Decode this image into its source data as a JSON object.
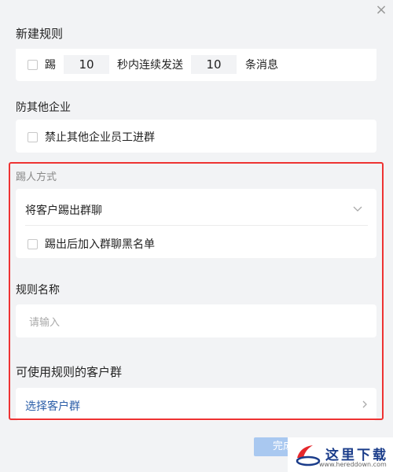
{
  "dialog": {
    "title": "新建规则",
    "close_glyph": "×",
    "complete_label": "完成"
  },
  "spam_rule": {
    "kick_label": "踢",
    "seconds_value": "10",
    "mid_text": "秒内连续发送",
    "count_value": "10",
    "end_text": "条消息"
  },
  "other_company": {
    "section_label": "防其他企业",
    "checkbox_label": "禁止其他企业员工进群"
  },
  "kick_method": {
    "section_label": "踢人方式",
    "selected_value": "将客户踢出群聊",
    "blacklist_label": "踢出后加入群聊黑名单"
  },
  "rule_name": {
    "section_label": "规则名称",
    "placeholder": "请输入"
  },
  "customer_groups": {
    "section_label": "可使用规则的客户群",
    "select_label": "选择客户群"
  },
  "watermark": {
    "text": "这里下载",
    "url": "www.hereddown.com"
  },
  "colors": {
    "highlight_border": "#e33333",
    "link": "#2b5ea8",
    "button_disabled": "#a9c8f0"
  }
}
